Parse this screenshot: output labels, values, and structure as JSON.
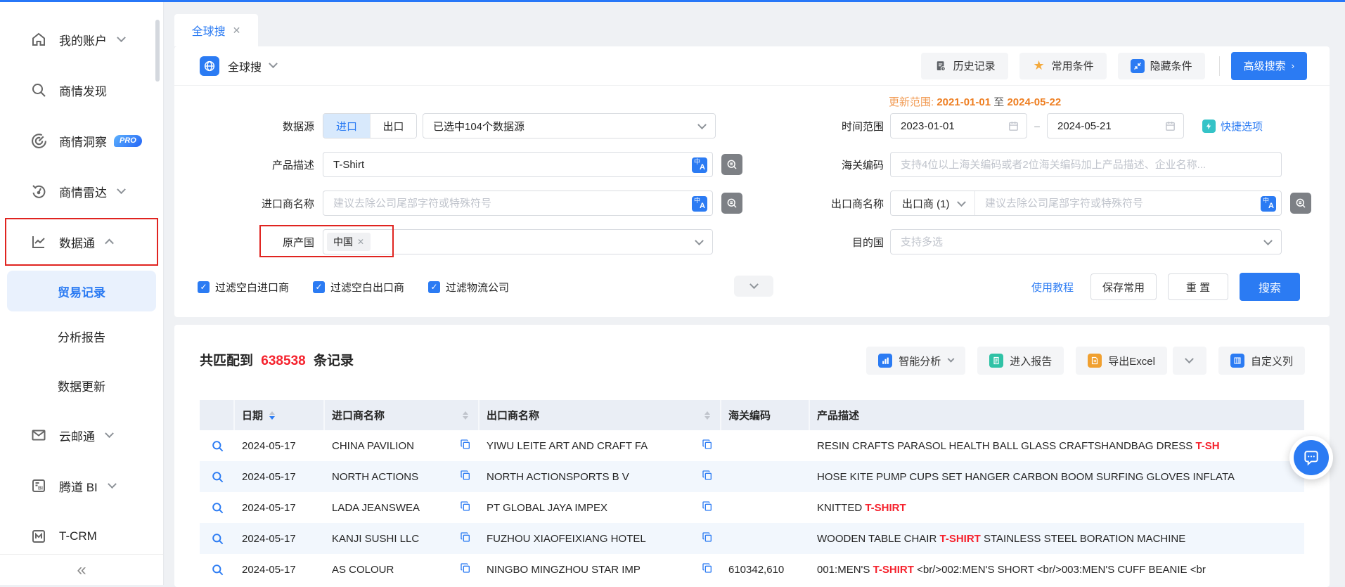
{
  "colors": {
    "accent": "#2b7bf3",
    "danger": "#f5222d",
    "orange": "#ee7e21",
    "teal": "#35c3c7",
    "star": "#f3a93c"
  },
  "sidebar": {
    "items": [
      {
        "label": "我的账户",
        "icon": "home-icon",
        "chevron": "down"
      },
      {
        "label": "商情发现",
        "icon": "search-icon"
      },
      {
        "label": "商情洞察",
        "icon": "insight-icon",
        "badge": "PRO"
      },
      {
        "label": "商情雷达",
        "icon": "radar-icon",
        "chevron": "down"
      },
      {
        "label": "数据通",
        "icon": "data-icon",
        "chevron": "up",
        "highlighted": true
      },
      {
        "label": "云邮通",
        "icon": "mail-icon",
        "chevron": "down"
      },
      {
        "label": "腾道 BI",
        "icon": "bi-icon",
        "chevron": "down"
      },
      {
        "label": "T-CRM",
        "icon": "crm-icon"
      }
    ],
    "sub_items": [
      "贸易记录",
      "分析报告",
      "数据更新"
    ],
    "active_sub_item": "贸易记录",
    "collapse_glyph": "«"
  },
  "tab": {
    "label": "全球搜",
    "close": "✕"
  },
  "toolbar": {
    "module_label": "全球搜",
    "history": "历史记录",
    "favorites": "常用条件",
    "hide": "隐藏条件",
    "advanced": "高级搜索",
    "advanced_arrow": "›"
  },
  "form": {
    "datasource_label": "数据源",
    "import_toggle": "进口",
    "export_toggle": "出口",
    "datasource_value": "已选中104个数据源",
    "time_label": "时间范围",
    "date_from": "2023-01-01",
    "date_to": "2024-05-21",
    "date_sep": "–",
    "quick_option": "快捷选项",
    "update_range_label": "更新范围:",
    "update_from": "2021-01-01",
    "update_word": "至",
    "update_to": "2024-05-22",
    "product_label": "产品描述",
    "product_value": "T-Shirt",
    "hs_label": "海关编码",
    "hs_placeholder": "支持4位以上海关编码或者2位海关编码加上产品描述、企业名称...",
    "importer_label": "进口商名称",
    "importer_placeholder": "建议去除公司尾部字符或特殊符号",
    "exporter_label": "出口商名称",
    "exporter_type": "出口商 (1)",
    "exporter_placeholder": "建议去除公司尾部字符或特殊符号",
    "origin_label": "原产国",
    "origin_tag": "中国",
    "origin_tag_close": "✕",
    "dest_label": "目的国",
    "dest_placeholder": "支持多选",
    "checkboxes": [
      "过滤空白进口商",
      "过滤空白出口商",
      "过滤物流公司"
    ],
    "tutorial": "使用教程",
    "save": "保存常用",
    "reset": "重 置",
    "search": "搜索"
  },
  "results": {
    "prefix": "共匹配到",
    "count": "638538",
    "suffix": "条记录",
    "analysis": "智能分析",
    "report": "进入报告",
    "export": "导出Excel",
    "columns": "自定义列"
  },
  "table": {
    "headers": {
      "date": "日期",
      "importer": "进口商名称",
      "exporter": "出口商名称",
      "hs": "海关编码",
      "product": "产品描述"
    },
    "rows": [
      {
        "date": "2024-05-17",
        "importer": "CHINA PAVILION",
        "exporter": "YIWU LEITE ART AND CRAFT FA",
        "hs": "",
        "product": [
          {
            "t": "RESIN CRAFTS PARASOL HEALTH BALL GLASS CRAFTSHANDBAG DRESS ",
            "h": false
          },
          {
            "t": "T-SH",
            "h": true
          }
        ]
      },
      {
        "date": "2024-05-17",
        "importer": "NORTH ACTIONS",
        "exporter": "NORTH ACTIONSPORTS B V",
        "hs": "",
        "product": [
          {
            "t": "HOSE KITE PUMP CUPS SET HANGER CARBON BOOM SURFING GLOVES INFLATA",
            "h": false
          }
        ]
      },
      {
        "date": "2024-05-17",
        "importer": "LADA JEANSWEA",
        "exporter": "PT GLOBAL JAYA IMPEX",
        "hs": "",
        "product": [
          {
            "t": "KNITTED ",
            "h": false
          },
          {
            "t": "T-SHIRT",
            "h": true
          }
        ]
      },
      {
        "date": "2024-05-17",
        "importer": "KANJI SUSHI LLC",
        "exporter": "FUZHOU XIAOFEIXIANG HOTEL",
        "hs": "",
        "product": [
          {
            "t": "WOODEN TABLE CHAIR ",
            "h": false
          },
          {
            "t": "T-SHIRT",
            "h": true
          },
          {
            "t": " STAINLESS STEEL BORATION MACHINE",
            "h": false
          }
        ]
      },
      {
        "date": "2024-05-17",
        "importer": "AS COLOUR",
        "exporter": "NINGBO MINGZHOU STAR IMP",
        "hs": "610342,610",
        "product": [
          {
            "t": "001:MEN'S ",
            "h": false
          },
          {
            "t": "T-SHIRT",
            "h": true
          },
          {
            "t": " <br/>002:MEN'S SHORT <br/>003:MEN'S CUFF BEANIE <br",
            "h": false
          }
        ]
      }
    ]
  }
}
